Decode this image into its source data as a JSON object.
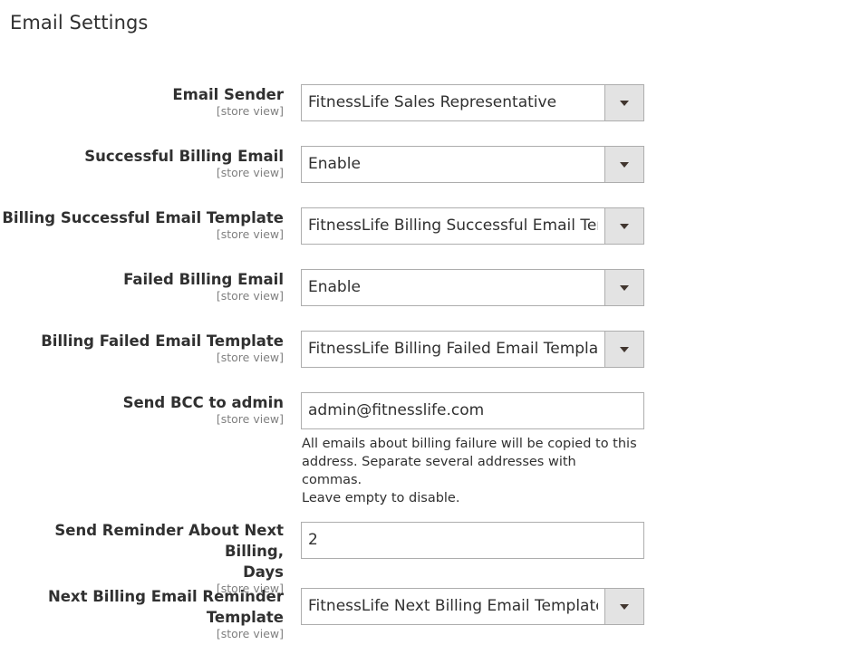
{
  "section": {
    "title": "Email Settings"
  },
  "fields": [
    {
      "label": "Email Sender",
      "scope": "[store view]",
      "value": "FitnessLife Sales Representative"
    },
    {
      "label": "Successful Billing Email",
      "scope": "[store view]",
      "value": "Enable"
    },
    {
      "label": "Billing Successful Email Template",
      "scope": "[store view]",
      "value": "FitnessLife Billing Successful Email Template"
    },
    {
      "label": "Failed Billing Email",
      "scope": "[store view]",
      "value": "Enable"
    },
    {
      "label": "Billing Failed Email Template",
      "scope": "[store view]",
      "value": "FitnessLife Billing Failed Email Template"
    },
    {
      "label": "Send BCC to admin",
      "scope": "[store view]",
      "value": "admin@fitnesslife.com",
      "note_lines": [
        "All emails about billing failure will be copied to this",
        "address. Separate several addresses with commas.",
        "Leave empty to disable."
      ]
    },
    {
      "label_lines": [
        "Send Reminder About Next Billing,",
        "Days"
      ],
      "scope": "[store view]",
      "value": "2"
    },
    {
      "label_lines": [
        "Next Billing Email Reminder",
        "Template"
      ],
      "scope": "[store view]",
      "value": "FitnessLife Next Billing Email Template"
    }
  ]
}
